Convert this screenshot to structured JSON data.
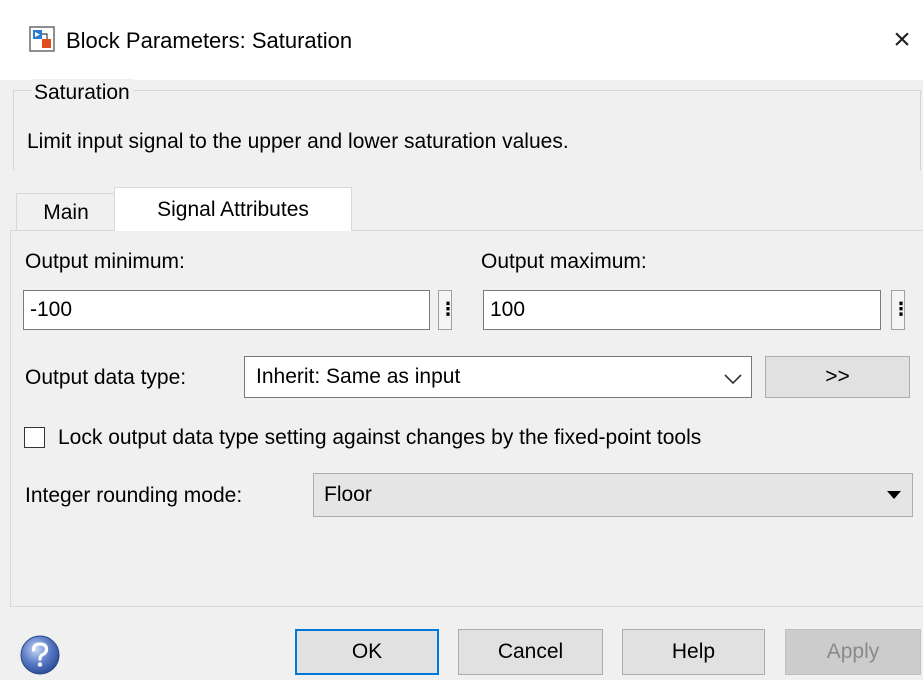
{
  "window": {
    "title": "Block Parameters: Saturation",
    "close_glyph": "×"
  },
  "group": {
    "legend": "Saturation",
    "description": "Limit input signal to the upper and lower saturation values."
  },
  "tabs": [
    {
      "label": "Main",
      "selected": false
    },
    {
      "label": "Signal Attributes",
      "selected": true
    }
  ],
  "signal_attributes": {
    "output_min_label": "Output minimum:",
    "output_min_value": "-100",
    "output_max_label": "Output maximum:",
    "output_max_value": "100",
    "more_glyph": "⋮",
    "output_type_label": "Output data type:",
    "output_type_value": "Inherit: Same as input",
    "assistant_button": ">>",
    "lock_label": "Lock output data type setting against changes by the fixed-point tools",
    "lock_checked": false,
    "rounding_label": "Integer rounding mode:",
    "rounding_value": "Floor"
  },
  "buttons": {
    "ok": "OK",
    "cancel": "Cancel",
    "help": "Help",
    "apply": "Apply"
  },
  "icons": {
    "app": "simulink-block-icon",
    "help": "help-question-icon"
  },
  "colors": {
    "focus": "#0078d7",
    "dialog_bg": "#f0f0f0"
  }
}
